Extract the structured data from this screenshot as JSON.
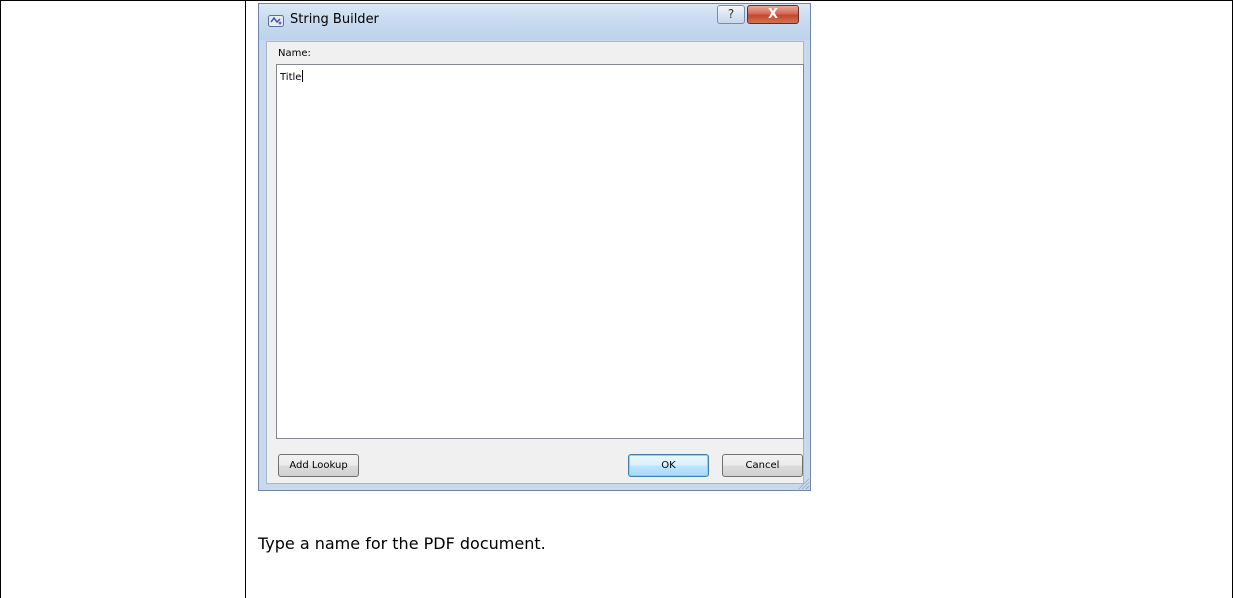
{
  "dialog": {
    "title": "String Builder",
    "icon": "string-builder-app-icon",
    "help_label": "?",
    "close_label": "X",
    "name_label": "Name:",
    "name_value": "Title",
    "buttons": {
      "add_lookup": "Add Lookup",
      "ok": "OK",
      "cancel": "Cancel"
    }
  },
  "instruction": "Type a name for the PDF document.",
  "colors": {
    "titlebar": "#c9dbf0",
    "close_button": "#c24733",
    "default_button_border": "#3c7fb1"
  }
}
